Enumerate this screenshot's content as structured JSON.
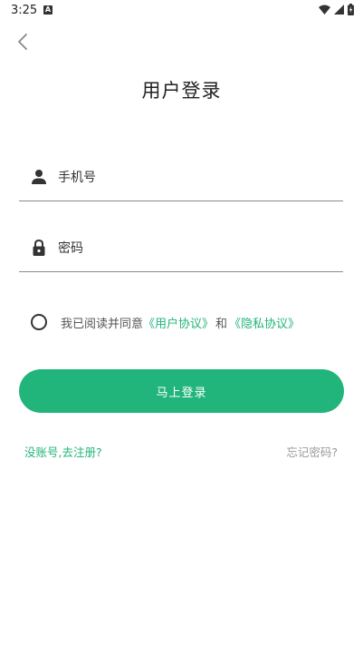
{
  "status_bar": {
    "time": "3:25",
    "notification_icon": "a-badge-icon",
    "wifi_icon": "wifi-icon",
    "signal_icon": "signal-icon",
    "battery_icon": "battery-icon"
  },
  "header": {
    "back_icon": "chevron-left-icon",
    "title": "用户登录"
  },
  "form": {
    "phone": {
      "icon": "person-icon",
      "placeholder": "手机号",
      "value": ""
    },
    "password": {
      "icon": "lock-icon",
      "placeholder": "密码",
      "value": ""
    }
  },
  "agreement": {
    "checked": false,
    "prefix": "我已阅读并同意",
    "user_agreement": "《用户协议》",
    "and": "和",
    "privacy_agreement": "《隐私协议》"
  },
  "login_button": "马上登录",
  "register_link": "没账号,去注册?",
  "forgot_link": "忘记密码?",
  "colors": {
    "accent": "#21b57b",
    "muted_text": "#9a9a9a"
  }
}
